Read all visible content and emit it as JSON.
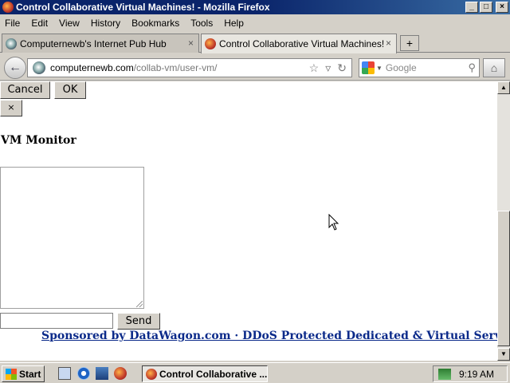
{
  "window": {
    "title": "Control Collaborative Virtual Machines! - Mozilla Firefox",
    "controls": {
      "minimize": "_",
      "maximize": "□",
      "close": "×"
    }
  },
  "menu": [
    "File",
    "Edit",
    "View",
    "History",
    "Bookmarks",
    "Tools",
    "Help"
  ],
  "tabs": [
    {
      "label": "Computernewb's Internet Pub Hub",
      "active": false,
      "icon": "globe-icon"
    },
    {
      "label": "Control Collaborative Virtual Machines!",
      "active": true,
      "icon": "firefox-icon"
    }
  ],
  "tab_close": "×",
  "new_tab": "+",
  "nav": {
    "back": "←",
    "url_host": "computernewb.com",
    "url_path": "/collab-vm/user-vm/",
    "search_placeholder": "Google",
    "home": "⌂"
  },
  "page": {
    "cancel_label": "Cancel",
    "ok_label": "OK",
    "close_label": "×",
    "vm_title": "VM Monitor",
    "chat_input_value": "",
    "send_label": "Send",
    "sponsor_text": "Sponsored by DataWagon.com · DDoS Protected Dedicated & Virtual Servers"
  },
  "taskbar": {
    "start_label": "Start",
    "task_label": "Control Collaborative ...",
    "clock": "9:19 AM"
  }
}
